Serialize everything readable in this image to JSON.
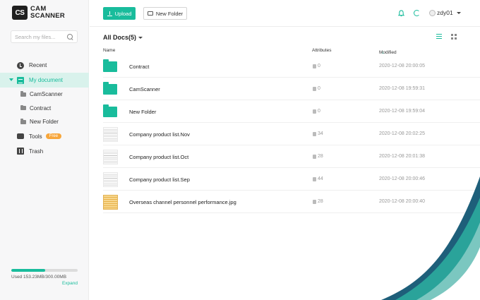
{
  "brand": {
    "badge": "CS",
    "line1": "CAM",
    "line2": "SCANNER"
  },
  "search": {
    "placeholder": "Search my files..."
  },
  "sidebar": {
    "items": [
      {
        "label": "Recent"
      },
      {
        "label": "My document"
      },
      {
        "label": "CamScanner"
      },
      {
        "label": "Contract"
      },
      {
        "label": "New Folder"
      },
      {
        "label": "Tools",
        "badge": "Free"
      },
      {
        "label": "Trash"
      }
    ]
  },
  "storage": {
    "used_label": "Used 153.23MB/300.00MB",
    "used_fraction": 0.51,
    "expand": "Expand"
  },
  "toolbar": {
    "upload": "Upload",
    "new_folder": "New Folder"
  },
  "user": {
    "name": "zdy01"
  },
  "list": {
    "title": "All Docs(5)",
    "columns": {
      "name": "Name",
      "attributes": "Attributes",
      "modified": "Modified"
    },
    "rows": [
      {
        "kind": "folder",
        "name": "Contract",
        "attr": "0",
        "modified": "2020-12-08 20:00:05"
      },
      {
        "kind": "folder",
        "name": "CamScanner",
        "attr": "0",
        "modified": "2020-12-08 19:59:31"
      },
      {
        "kind": "folder",
        "name": "New Folder",
        "attr": "0",
        "modified": "2020-12-08 19:59:04"
      },
      {
        "kind": "doc",
        "name": "Company product list.Nov",
        "attr": "34",
        "modified": "2020-12-08 20:02:25"
      },
      {
        "kind": "doc",
        "name": "Company product list.Oct",
        "attr": "28",
        "modified": "2020-12-08 20:01:38"
      },
      {
        "kind": "doc",
        "name": "Company product list.Sep",
        "attr": "44",
        "modified": "2020-12-08 20:00:46"
      },
      {
        "kind": "image",
        "name": "Overseas channel personnel performance.jpg",
        "attr": "28",
        "modified": "2020-12-08 20:00:40"
      }
    ]
  },
  "colors": {
    "accent": "#19bc9c",
    "free_badge": "#f7a63b",
    "swoosh_dark": "#1e5f7a",
    "swoosh_mid": "#2aa39a"
  }
}
